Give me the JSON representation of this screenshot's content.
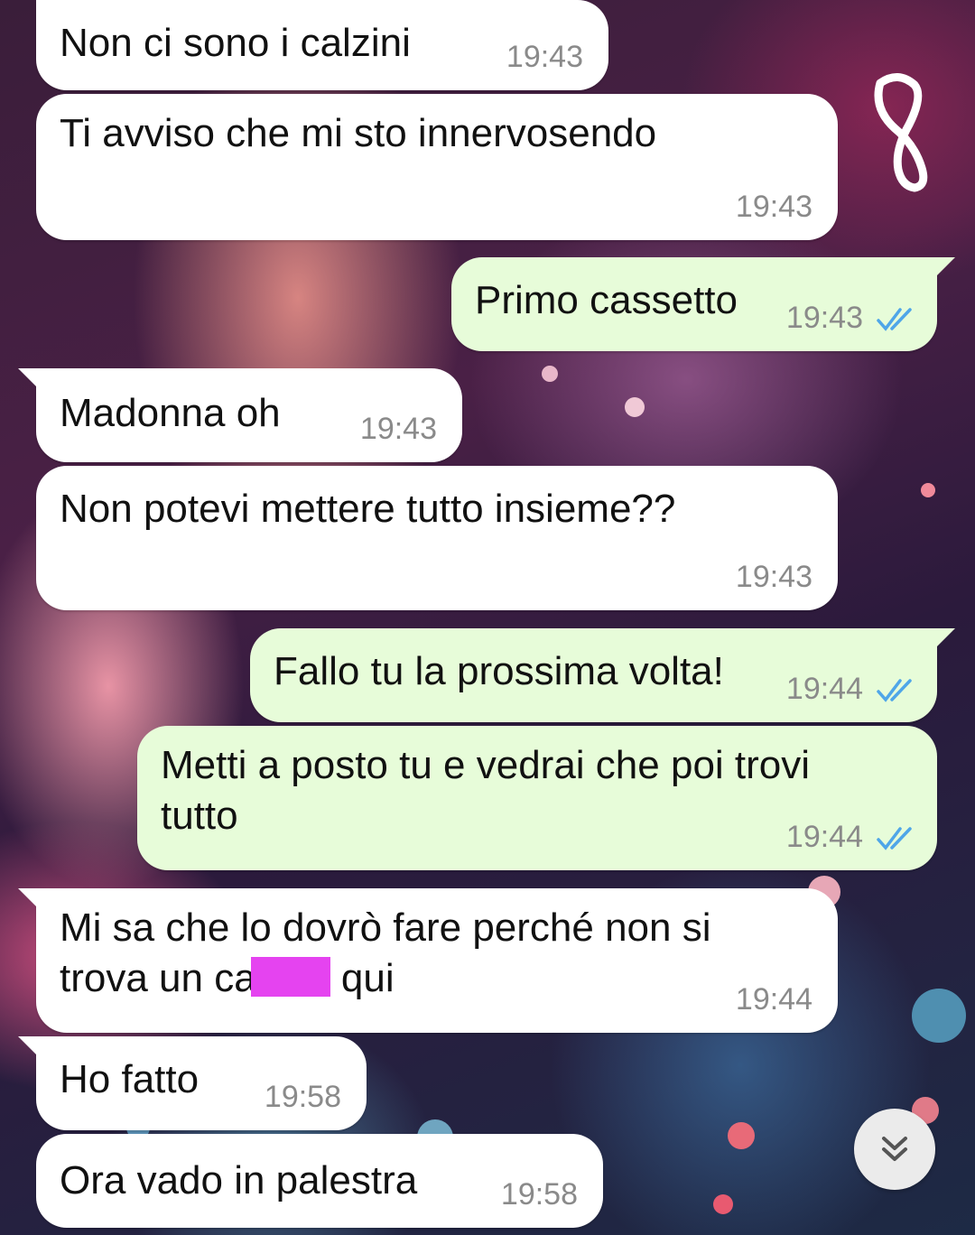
{
  "chat": {
    "messages": [
      {
        "text": "Non ci sono i calzini",
        "time": "19:43",
        "direction": "incoming"
      },
      {
        "text": "Ti avviso che mi sto innervosendo",
        "time": "19:43",
        "direction": "incoming"
      },
      {
        "text": "Primo cassetto",
        "time": "19:43",
        "direction": "outgoing",
        "status": "read"
      },
      {
        "text": "Madonna oh",
        "time": "19:43",
        "direction": "incoming"
      },
      {
        "text": "Non potevi mettere tutto insieme??",
        "time": "19:43",
        "direction": "incoming"
      },
      {
        "text": "Fallo tu la prossima volta!",
        "time": "19:44",
        "direction": "outgoing",
        "status": "read"
      },
      {
        "text": "Metti a posto tu e vedrai che poi trovi tutto",
        "time": "19:44",
        "direction": "outgoing",
        "status": "read"
      },
      {
        "text_before": "Mi sa che lo dovrò fare perché non si trova un ca",
        "text_after": "qui",
        "time": "19:44",
        "direction": "incoming",
        "redacted": true
      },
      {
        "text": "Ho fatto",
        "time": "19:58",
        "direction": "incoming"
      },
      {
        "text": "Ora vado in palestra",
        "time": "19:58",
        "direction": "incoming"
      }
    ]
  },
  "colors": {
    "incoming_bubble": "#ffffff",
    "outgoing_bubble": "#e7fcd9",
    "read_ticks": "#4fa6e8",
    "redaction": "#e543f0"
  },
  "icons": {
    "read_receipt": "double-check-icon",
    "scroll_down": "double-chevron-down-icon",
    "annotation": "figure-eight-drawing"
  }
}
